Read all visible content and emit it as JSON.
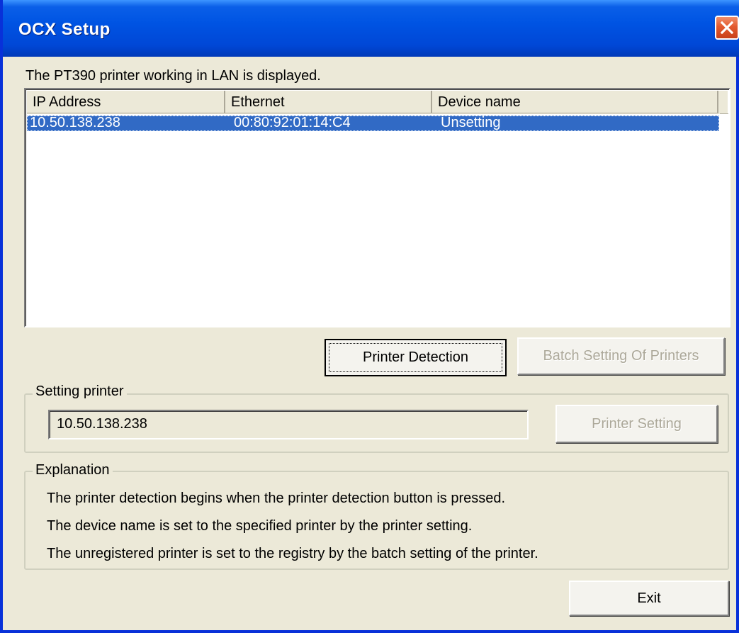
{
  "window": {
    "title": "OCX Setup"
  },
  "caption": "The PT390 printer working in LAN is displayed.",
  "list": {
    "columns": [
      "IP Address",
      "Ethernet",
      "Device name"
    ],
    "rows": [
      {
        "ip": "10.50.138.238",
        "ethernet": "00:80:92:01:14:C4",
        "device": "Unsetting",
        "selected": true
      }
    ]
  },
  "buttons": {
    "detection": "Printer Detection",
    "batch": "Batch Setting Of Printers",
    "setting": "Printer Setting",
    "exit": "Exit"
  },
  "setting_group": {
    "label": "Setting printer",
    "value": "10.50.138.238"
  },
  "explanation": {
    "label": "Explanation",
    "lines": [
      "The printer detection begins when the printer detection button is pressed.",
      "The device name is set to the specified printer by the printer setting.",
      "The unregistered printer is set to the registry by the batch setting of the printer."
    ]
  },
  "colors": {
    "titlebar": "#0054E3",
    "selection": "#316AC5",
    "dialog_bg": "#ECE9D8",
    "close": "#E35A2E"
  },
  "icons": {
    "close": "close-x-icon"
  }
}
